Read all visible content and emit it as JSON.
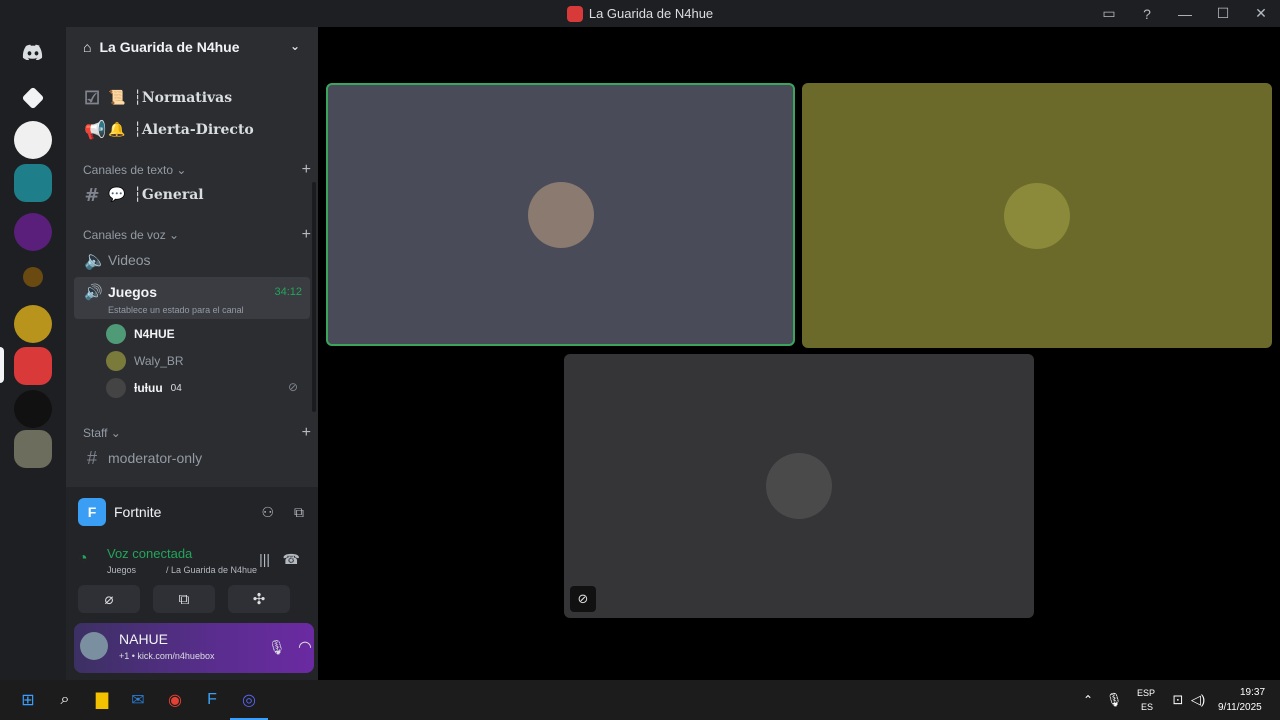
{
  "window": {
    "title": "La Guarida de N4hue",
    "controls": [
      "inbox-icon",
      "help-icon",
      "minimize-icon",
      "maximize-icon",
      "close-icon"
    ]
  },
  "server_header": {
    "name": "La Guarida de N4hue"
  },
  "channels_top": [
    {
      "icon": "rules-icon",
      "emoji": "📜",
      "label": "┆Normativas"
    },
    {
      "icon": "announce-icon",
      "emoji": "🔔",
      "label": "┆Alerta-Directo"
    }
  ],
  "categories": {
    "text": "Canales de texto",
    "voice": "Canales de voz",
    "staff": "Staff"
  },
  "text_channels": [
    {
      "emoji": "💬",
      "label": "┆General"
    }
  ],
  "voice_channels": {
    "videos": "Videos",
    "juegos": "Juegos",
    "timer": "34:12",
    "status_hint": "Establece un estado para el canal",
    "members": [
      {
        "name": "N4HUE"
      },
      {
        "name": "Waly_BR"
      },
      {
        "name": "ƚuƚuu",
        "badge": "04"
      }
    ]
  },
  "staff_channels": [
    {
      "label": "moderator-only"
    }
  ],
  "activity": {
    "game": "Fortnite"
  },
  "voice_status": {
    "title": "Voz conectada",
    "channel": "Juegos",
    "server": "/ La Guarida de N4hue"
  },
  "user": {
    "name": "NAHUE",
    "status": "+1 • kick.com/n4huebox"
  },
  "taskbar": {
    "lang_top": "ESP",
    "lang_bottom": "ES",
    "time": "19:37",
    "date": "9/11/2025"
  },
  "colors": {
    "speaking_border": "#3ba55d",
    "tile1": "#4a4b58",
    "tile2": "#6b6a2a",
    "tile3": "#353538",
    "accent_green": "#23a55a",
    "purple": "#5a2d8f"
  }
}
